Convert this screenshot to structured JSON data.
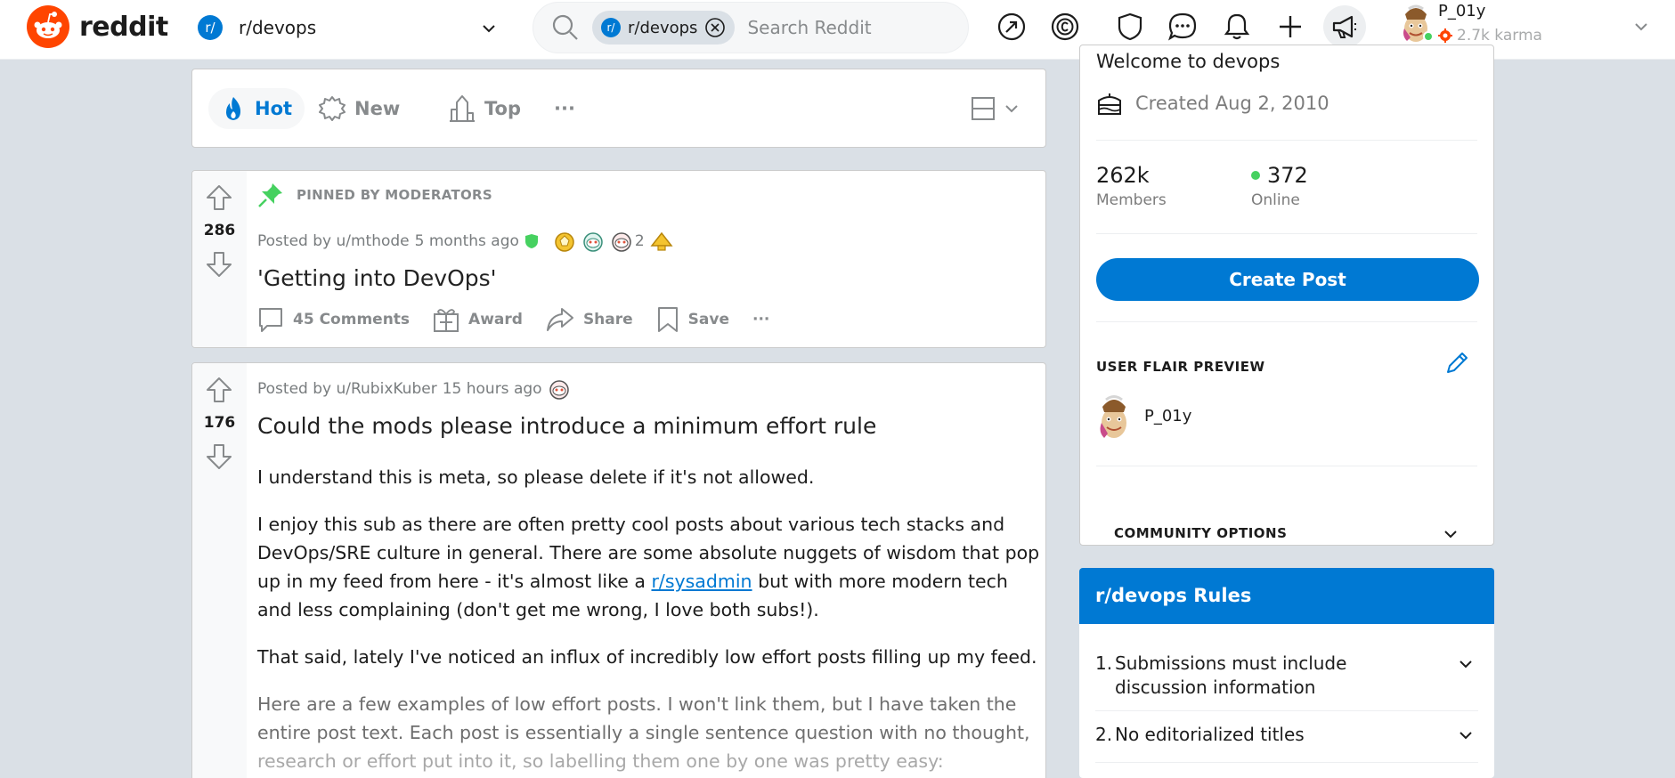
{
  "header": {
    "logo_text": "reddit",
    "community": "r/devops",
    "community_icon": "r/",
    "search": {
      "chip_label": "r/devops",
      "chip_icon": "r/",
      "placeholder": "Search Reddit"
    },
    "icons": [
      "popular-icon",
      "coins-icon",
      "mod-shield-icon",
      "chat-icon",
      "notifications-icon",
      "create-post-icon",
      "advertise-icon"
    ],
    "user": {
      "name": "P_01y",
      "karma": "2.7k karma"
    }
  },
  "sort": {
    "hot": "Hot",
    "new": "New",
    "top": "Top",
    "more": "···"
  },
  "posts": [
    {
      "pinned_label": "PINNED BY MODERATORS",
      "votes": "286",
      "posted_by": "Posted by u/mthode",
      "time": "5 months ago",
      "award_count": "2",
      "title": "'Getting into DevOps'",
      "comments": "45 Comments",
      "award": "Award",
      "share": "Share",
      "save": "Save",
      "more": "···"
    },
    {
      "votes": "176",
      "posted_by": "Posted by u/RubixKuber",
      "time": "15 hours ago",
      "title": "Could the mods please introduce a minimum effort rule",
      "p1": "I understand this is meta, so please delete if it's not allowed.",
      "p2_a": "I enjoy this sub as there are often pretty cool posts about various tech stacks and DevOps/SRE culture in general. There are some absolute nuggets of wisdom that pop up in my feed from here - it's almost like a ",
      "p2_link": "r/sysadmin",
      "p2_b": " but with more modern tech and less complaining (don't get me wrong, I love both subs!).",
      "p3": "That said, lately I've noticed an influx of incredibly low effort posts filling up my feed.",
      "p4_a": "Here are a few examples of low effort posts. I won't link them, but I have taken the entire post text. Each post is essentially a single sentence question with no thought,",
      "p4_b": "research or effort put into it, so labelling them one by one was pretty easy:"
    }
  ],
  "sidebar": {
    "welcome": "Welcome to devops",
    "created": "Created Aug 2, 2010",
    "members_count": "262k",
    "members_label": "Members",
    "online_count": "372",
    "online_label": "Online",
    "create_post": "Create Post",
    "flair_title": "USER FLAIR PREVIEW",
    "flair_user": "P_01y",
    "community_options": "COMMUNITY OPTIONS"
  },
  "rules": {
    "title": "r/devops Rules",
    "items": [
      {
        "num": "1.",
        "text": "Submissions must include discussion information"
      },
      {
        "num": "2.",
        "text": "No editorialized titles"
      }
    ]
  },
  "colors": {
    "brand_orange": "#ff4500",
    "accent_blue": "#0079d3",
    "mod_green": "#46d160",
    "background": "#dae0e6"
  }
}
